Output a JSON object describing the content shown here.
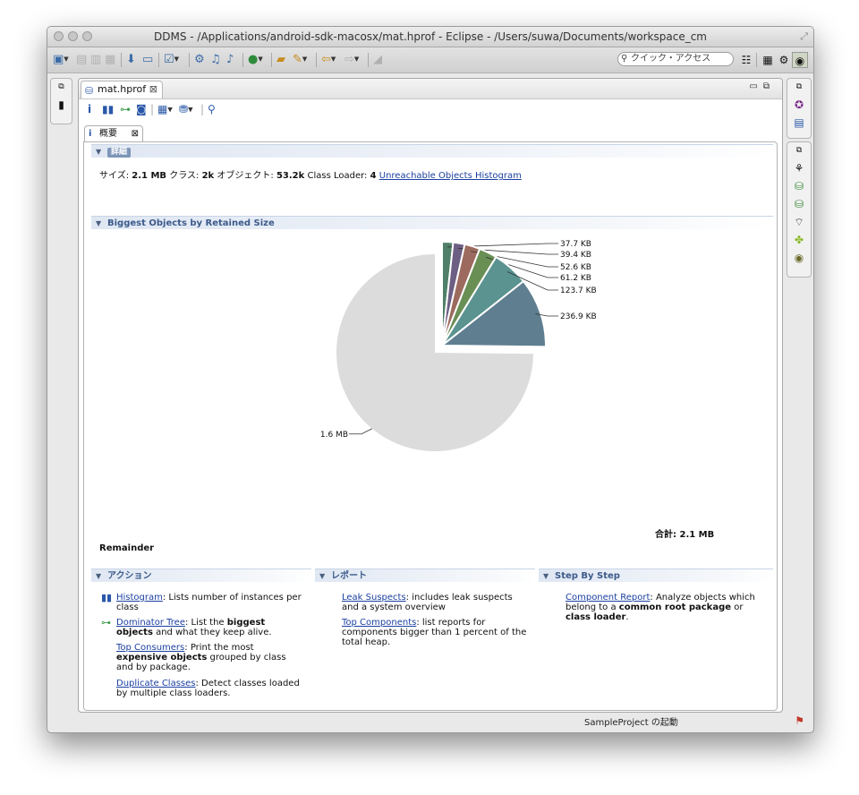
{
  "window": {
    "title": "DDMS - /Applications/android-sdk-macosx/mat.hprof - Eclipse - /Users/suwa/Documents/workspace_cm"
  },
  "toolbar": {
    "quick_access_placeholder": "クイック・アクセス"
  },
  "editor_tab": {
    "label": "mat.hprof"
  },
  "overview_tab": {
    "label": "概要"
  },
  "details_section": {
    "header": "詳細",
    "size_label": "サイズ:",
    "size_value": "2.1 MB",
    "classes_label": "クラス:",
    "classes_value": "2k",
    "objects_label": "オブジェクト:",
    "objects_value": "53.2k",
    "loader_label": "Class Loader:",
    "loader_value": "4",
    "unreachable_link": "Unreachable Objects Histogram"
  },
  "biggest_section": {
    "header": "Biggest Objects by Retained Size",
    "total_label": "合計: 2.1 MB",
    "remainder_label": "Remainder"
  },
  "chart_data": {
    "type": "pie",
    "unit": "KB",
    "slices": [
      {
        "label": "1.6 MB",
        "value": 1638.4,
        "color": "#dcdcdc"
      },
      {
        "label": "236.9 KB",
        "value": 236.9,
        "color": "#5f7f90"
      },
      {
        "label": "123.7 KB",
        "value": 123.7,
        "color": "#5a9390"
      },
      {
        "label": "61.2 KB",
        "value": 61.2,
        "color": "#6a8f55"
      },
      {
        "label": "52.6 KB",
        "value": 52.6,
        "color": "#9c6a5e"
      },
      {
        "label": "39.4 KB",
        "value": 39.4,
        "color": "#6d5f83"
      },
      {
        "label": "37.7 KB",
        "value": 37.7,
        "color": "#4f7f68"
      }
    ]
  },
  "actions": {
    "header": "アクション",
    "items": [
      {
        "link": "Histogram",
        "text": ": Lists number of instances per class",
        "icon": "histogram-icon"
      },
      {
        "link": "Dominator Tree",
        "text_pre": ": List the ",
        "text_bold": "biggest objects",
        "text_post": " and what they keep alive.",
        "icon": "dominator-tree-icon"
      },
      {
        "link": "Top Consumers",
        "text_pre": ": Print the most ",
        "text_bold": "expensive objects",
        "text_post": " grouped by class and by package."
      },
      {
        "link": "Duplicate Classes",
        "text": ": Detect classes loaded by multiple class loaders."
      }
    ]
  },
  "reports": {
    "header": "レポート",
    "items": [
      {
        "link": "Leak Suspects",
        "text": ": includes leak suspects and a system overview"
      },
      {
        "link": "Top Components",
        "text": ": list reports for components bigger than 1 percent of the total heap."
      }
    ]
  },
  "step_by_step": {
    "header": "Step By Step",
    "items": [
      {
        "link": "Component Report",
        "text_pre": ": Analyze objects which belong to a ",
        "text_bold1": "common root package",
        "text_mid": " or ",
        "text_bold2": "class loader",
        "text_post": "."
      }
    ]
  },
  "status": {
    "text": "SampleProject の起動"
  }
}
